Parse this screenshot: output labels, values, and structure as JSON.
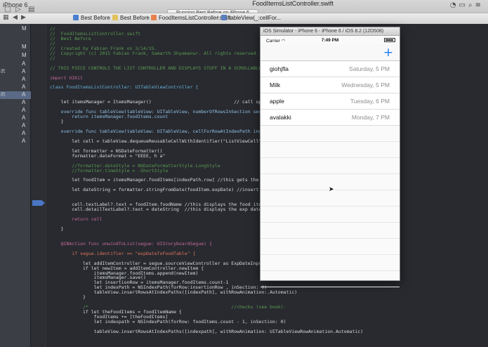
{
  "simulator_label": "iPhone 6",
  "window": {
    "title": "FoodItemsListController.swift",
    "status": "Running Best Before on iPhone 6"
  },
  "jumpbar": {
    "items": [
      "Best Before",
      "Best Before",
      "FoodItemsListController.swift",
      "tableView(_:cellFor..."
    ]
  },
  "navigator": {
    "rows": [
      {
        "name": "",
        "status": "M"
      },
      {
        "name": "",
        "status": "M"
      },
      {
        "name": "",
        "status": "M"
      },
      {
        "name": "",
        "status": "A"
      },
      {
        "name": "ift",
        "status": "A"
      },
      {
        "name": "",
        "status": "A"
      },
      {
        "name": "",
        "status": "A"
      },
      {
        "name": "ift",
        "status": "A"
      },
      {
        "name": "",
        "status": "A"
      },
      {
        "name": "",
        "status": "A"
      },
      {
        "name": "",
        "status": "A"
      },
      {
        "name": "",
        "status": "A"
      },
      {
        "name": "",
        "status": "A"
      },
      {
        "name": "",
        "status": "A"
      }
    ]
  },
  "code": {
    "lines": [
      {
        "cls": "c-com",
        "text": "//"
      },
      {
        "cls": "c-com",
        "text": "//  FoodItemsListController.swift"
      },
      {
        "cls": "c-com",
        "text": "//  Best Before"
      },
      {
        "cls": "c-com",
        "text": "//"
      },
      {
        "cls": "c-com",
        "text": "//  Created by Fabian Frank on 3/14/15."
      },
      {
        "cls": "c-com",
        "text": "//  Copyright (c) 2015 Fabian Frank, Samarth Shyamanur. All rights reserved."
      },
      {
        "cls": "c-com",
        "text": "//"
      },
      {
        "cls": "",
        "text": ""
      },
      {
        "cls": "c-com",
        "text": "// THIS PIECE CONTROLS THE LIST CONTROLLER AND DISPLAYS STUFF IN A SCROLLABLE LIST"
      },
      {
        "cls": "",
        "text": ""
      },
      {
        "cls": "c-kw",
        "text": "import UIKit"
      },
      {
        "cls": "",
        "text": ""
      },
      {
        "cls": "c-ty",
        "text": "class FoodItemsListController: UITableViewController {"
      },
      {
        "cls": "",
        "text": ""
      },
      {
        "cls": "",
        "text": ""
      },
      {
        "cls": "",
        "text": "    let itemsManager = ItemsManager()                              // call up the itemsM"
      },
      {
        "cls": "",
        "text": ""
      },
      {
        "cls": "c-fn",
        "text": "    override func tableView(tableView: UITableView, numberOfRowsInSection section:"
      },
      {
        "cls": "c-fn",
        "text": "        return itemsManager.foodItems.count"
      },
      {
        "cls": "",
        "text": "    }"
      },
      {
        "cls": "",
        "text": ""
      },
      {
        "cls": "c-fn",
        "text": "    override func tableView(tableView: UITableView, cellForRowAtIndexPath indexPat"
      },
      {
        "cls": "",
        "text": ""
      },
      {
        "cls": "",
        "text": "        let cell = tableView.dequeueReusableCellWithIdentifier(\"ListViewCell\", for"
      },
      {
        "cls": "",
        "text": ""
      },
      {
        "cls": "",
        "text": "        let formatter = NSDateFormatter()"
      },
      {
        "cls": "",
        "text": "        formatter.dateFormat = \"EEEE, h a\""
      },
      {
        "cls": "",
        "text": ""
      },
      {
        "cls": "c-com",
        "text": "        //formatter.dateStyle = NSDateFormatterStyle.LongStyle"
      },
      {
        "cls": "c-com",
        "text": "        //formatter.timeStyle = .ShortStyle"
      },
      {
        "cls": "",
        "text": ""
      },
      {
        "cls": "",
        "text": "        let foodItem = itemsManager.foodItems[indexPath.row] //this gets the cell"
      },
      {
        "cls": "",
        "text": ""
      },
      {
        "cls": "",
        "text": "        let dateString = formatter.stringFromDate(foodItem.expDate) //insert thin         nverted format."
      },
      {
        "cls": "",
        "text": ""
      },
      {
        "cls": "",
        "text": ""
      },
      {
        "cls": "",
        "text": "        cell.textLabel?.text = foodItem.foodName //this displays the food item nam"
      },
      {
        "cls": "",
        "text": "        cell.detailTextLabel?.text = dateString  //this displays the exp date foo"
      },
      {
        "cls": "",
        "text": ""
      },
      {
        "cls": "c-kw",
        "text": "        return cell"
      },
      {
        "cls": "",
        "text": ""
      },
      {
        "cls": "",
        "text": "    }"
      },
      {
        "cls": "",
        "text": ""
      },
      {
        "cls": "",
        "text": ""
      },
      {
        "cls": "c-kw",
        "text": "    @IBAction func unwindToList(segue: UIStoryboardSegue) {"
      },
      {
        "cls": "",
        "text": ""
      },
      {
        "cls": "c-str",
        "text": "        if segue.identifier == \"expDateToFoodTable\" {"
      },
      {
        "cls": "",
        "text": ""
      },
      {
        "cls": "",
        "text": "            let addItemController = segue.sourceViewController as ExpDateInputCont"
      },
      {
        "cls": "",
        "text": "            if let newItem = addItemController.newItem {"
      },
      {
        "cls": "",
        "text": "                itemsManager.foodItems.append(newItem)"
      },
      {
        "cls": "",
        "text": "                itemsManager.save()"
      },
      {
        "cls": "",
        "text": "                let insertionRow = itemsManager.foodItems.count-1"
      },
      {
        "cls": "",
        "text": "                let indexPath = NSIndexPath(forRow:insertionRow , inSection: 0)"
      },
      {
        "cls": "",
        "text": "                tableView.insertRowsAtIndexPaths([indexPath], withRowAnimation:.Automatic)"
      },
      {
        "cls": "",
        "text": "            }"
      },
      {
        "cls": "",
        "text": ""
      },
      {
        "cls": "c-com",
        "text": "            /*                                                    //checks (see book)-"
      },
      {
        "cls": "",
        "text": "            if let theFoodItems = foodItemName {"
      },
      {
        "cls": "",
        "text": "                foodItems += [theFoodItems]"
      },
      {
        "cls": "",
        "text": "                let indexpath = NSIndexPath(forRow: foodItems.count - 1, inSection: 0)"
      },
      {
        "cls": "",
        "text": ""
      },
      {
        "cls": "",
        "text": "                tableView.insertRowsAtIndexPaths([indexpath], withRowAnimation: UITableViewRowAnimation.Automatic)"
      }
    ]
  },
  "simulator": {
    "title": "iOS Simulator - iPhone 6 - iPhone 6 / iOS 8.2 (12D508)",
    "carrier": "Carrier",
    "time": "7:49 PM",
    "add_label": "+",
    "items": [
      {
        "name": "giohjfla",
        "date": "Saturday, 5 PM"
      },
      {
        "name": "Milk",
        "date": "Wednesday, 5 PM"
      },
      {
        "name": "apple",
        "date": "Tuesday, 6 PM"
      },
      {
        "name": "avalakki",
        "date": "Monday, 7 PM"
      }
    ]
  },
  "colors": {
    "editor_bg": "#282a2f",
    "comment": "#5b9a52",
    "keyword": "#c86a9c",
    "type": "#67b1d8",
    "string": "#e0735c",
    "ios_tint": "#1a7cf5"
  }
}
